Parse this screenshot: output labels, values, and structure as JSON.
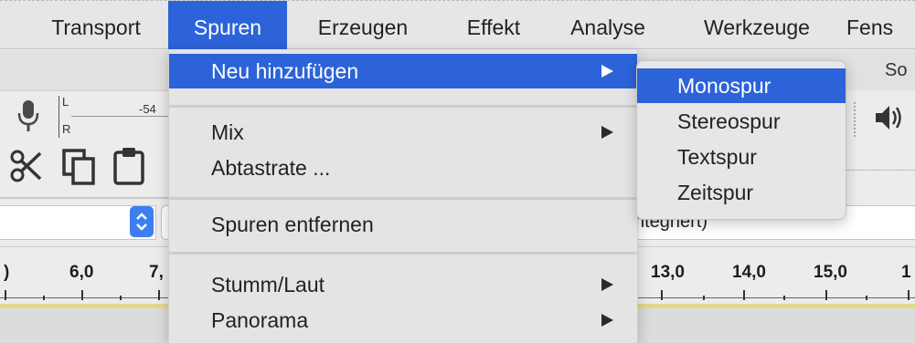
{
  "menubar": {
    "items": [
      {
        "label": "Transport"
      },
      {
        "label": "Spuren",
        "active": true
      },
      {
        "label": "Erzeugen"
      },
      {
        "label": "Effekt"
      },
      {
        "label": "Analyse"
      },
      {
        "label": "Werkzeuge"
      },
      {
        "label": "Fens"
      }
    ]
  },
  "background": {
    "right_toolbar_partial": "So",
    "meter": {
      "left_label": "L",
      "right_label": "R",
      "db_value": "-54"
    },
    "device_partial": "ntegriert)",
    "ruler_partial_left": ")",
    "ruler_ticks": [
      "6,0",
      "7,",
      "13,0",
      "14,0",
      "15,0",
      "1"
    ]
  },
  "dropdown": {
    "items": [
      {
        "label": "Neu hinzufügen",
        "submenu": true,
        "highlight": true
      },
      {
        "label": "Mix",
        "submenu": true
      },
      {
        "label": "Abtastrate ..."
      },
      {
        "label": "Spuren entfernen"
      },
      {
        "label": "Stumm/Laut",
        "submenu": true
      },
      {
        "label": "Panorama",
        "submenu": true
      }
    ]
  },
  "submenu": {
    "items": [
      {
        "label": "Monospur",
        "highlight": true
      },
      {
        "label": "Stereospur"
      },
      {
        "label": "Textspur"
      },
      {
        "label": "Zeitspur"
      }
    ]
  },
  "colors": {
    "accent": "#2c63d8",
    "menu_bg": "#e4e4e4",
    "waveform_yellow": "#e3d98a"
  },
  "icons": [
    "microphone-icon",
    "cut-icon",
    "copy-icon",
    "paste-icon",
    "stepper-icon",
    "speaker-icon"
  ]
}
